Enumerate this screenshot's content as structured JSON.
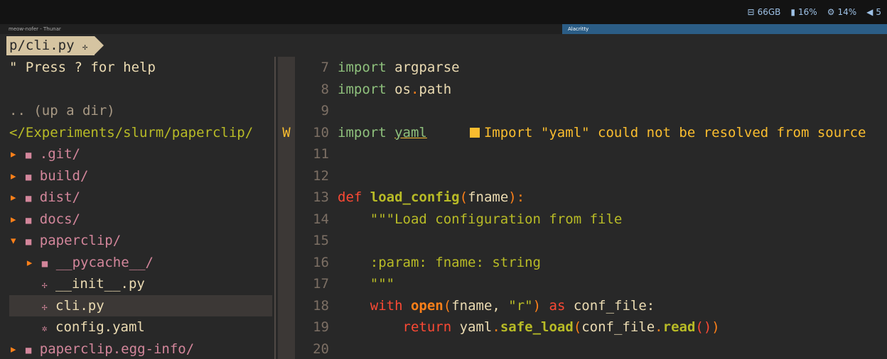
{
  "status_bar": {
    "disk": "66GB",
    "memory": "16%",
    "cpu": "14%",
    "volume": "5"
  },
  "window_titles": {
    "left": "meow-nofer - Thunar",
    "right": "Alacritty"
  },
  "tree": {
    "tab_label": "p/cli.py",
    "help_text": "\" Press ? for help",
    "up_dir": ".. (up a dir)",
    "root_path": "</Experiments/slurm/paperclip/",
    "items": [
      {
        "label": ".git/"
      },
      {
        "label": "build/"
      },
      {
        "label": "dist/"
      },
      {
        "label": "docs/"
      },
      {
        "label": "paperclip/"
      },
      {
        "label": "__pycache__/"
      },
      {
        "label": "__init__.py"
      },
      {
        "label": "cli.py"
      },
      {
        "label": "config.yaml"
      },
      {
        "label": "paperclip.egg-info/"
      }
    ]
  },
  "editor": {
    "sign_marker": "W",
    "lines": [
      {
        "num": "7",
        "text": "import argparse"
      },
      {
        "num": "8",
        "text": "import os.path"
      },
      {
        "num": "9",
        "text": ""
      },
      {
        "num": "10",
        "text": "import yaml"
      },
      {
        "num": "11",
        "text": ""
      },
      {
        "num": "12",
        "text": ""
      },
      {
        "num": "13",
        "text": "def load_config(fname):"
      },
      {
        "num": "14",
        "text": "    \"\"\"Load configuration from file"
      },
      {
        "num": "15",
        "text": ""
      },
      {
        "num": "16",
        "text": "    :param: fname: string"
      },
      {
        "num": "17",
        "text": "    \"\"\""
      },
      {
        "num": "18",
        "text": "    with open(fname, \"r\") as conf_file:"
      },
      {
        "num": "19",
        "text": "        return yaml.safe_load(conf_file.read())"
      },
      {
        "num": "20",
        "text": ""
      }
    ],
    "diagnostic": "Import \"yaml\" could not be resolved from source"
  }
}
